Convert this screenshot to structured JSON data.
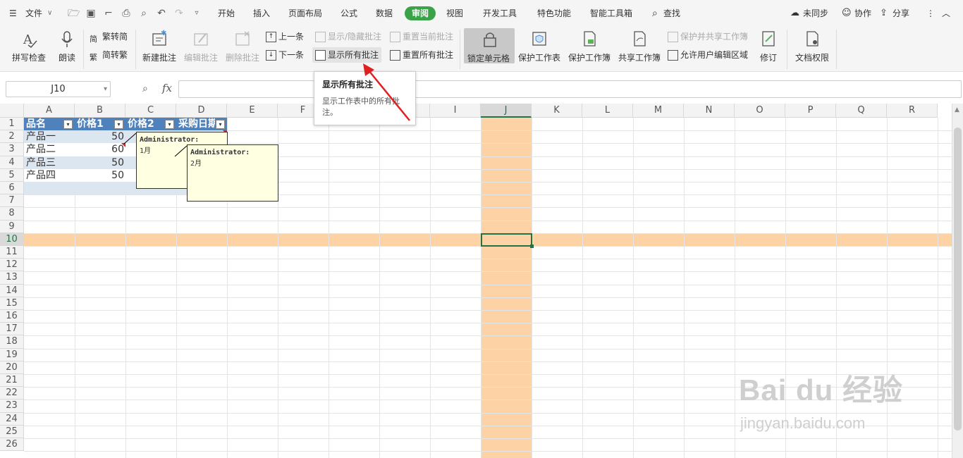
{
  "menu": {
    "file": "文件",
    "tabs": [
      "开始",
      "插入",
      "页面布局",
      "公式",
      "数据",
      "审阅",
      "视图",
      "开发工具",
      "特色功能",
      "智能工具箱"
    ],
    "search": "查找",
    "sync": "未同步",
    "collab": "协作",
    "share": "分享"
  },
  "ribbon": {
    "spell_check": "拼写检查",
    "read_aloud": "朗读",
    "trad_to_simp": "繁转简",
    "simp_to_trad": "简转繁",
    "new_comment": "新建批注",
    "edit_comment": "编辑批注",
    "delete_comment": "删除批注",
    "prev": "上一条",
    "next": "下一条",
    "show_hide": "显示/隐藏批注",
    "reset_current": "重置当前批注",
    "show_all": "显示所有批注",
    "reset_all": "重置所有批注",
    "lock_cells": "锁定单元格",
    "protect_sheet": "保护工作表",
    "protect_book": "保护工作簿",
    "share_book": "共享工作簿",
    "protect_share": "保护并共享工作簿",
    "allow_edit": "允许用户编辑区域",
    "revise": "修订",
    "doc_rights": "文档权限"
  },
  "formula_bar": {
    "name_box": "J10",
    "fx": "fx",
    "value": ""
  },
  "columns": [
    "A",
    "B",
    "C",
    "D",
    "E",
    "F",
    "G",
    "H",
    "I",
    "J",
    "K",
    "L",
    "M",
    "N",
    "O",
    "P",
    "Q",
    "R"
  ],
  "rows": [
    "1",
    "2",
    "3",
    "4",
    "5",
    "6",
    "7",
    "8",
    "9",
    "10",
    "11",
    "12",
    "13",
    "14",
    "15",
    "16",
    "17",
    "18",
    "19",
    "20",
    "21",
    "22",
    "23",
    "24",
    "25",
    "26"
  ],
  "table": {
    "headers": [
      "品名",
      "价格1",
      "价格2",
      "采购日期"
    ],
    "rows": [
      [
        "产品一",
        "50"
      ],
      [
        "产品二",
        "60"
      ],
      [
        "产品三",
        "50"
      ],
      [
        "产品四",
        "50"
      ]
    ]
  },
  "comments": [
    {
      "author": "Administrator:",
      "text": "1月"
    },
    {
      "author": "Administrator:",
      "text": "2月"
    }
  ],
  "tooltip": {
    "title": "显示所有批注",
    "desc": "显示工作表中的所有批注。"
  },
  "watermark": {
    "brand": "Bai du 经验",
    "site": "jingyan.baidu.com"
  },
  "colors": {
    "accent": "#3aa34a",
    "highlight": "#fdd3a6",
    "table_header": "#4f81bd",
    "table_band": "#dce6f1",
    "comment_bg": "#ffffe1"
  }
}
